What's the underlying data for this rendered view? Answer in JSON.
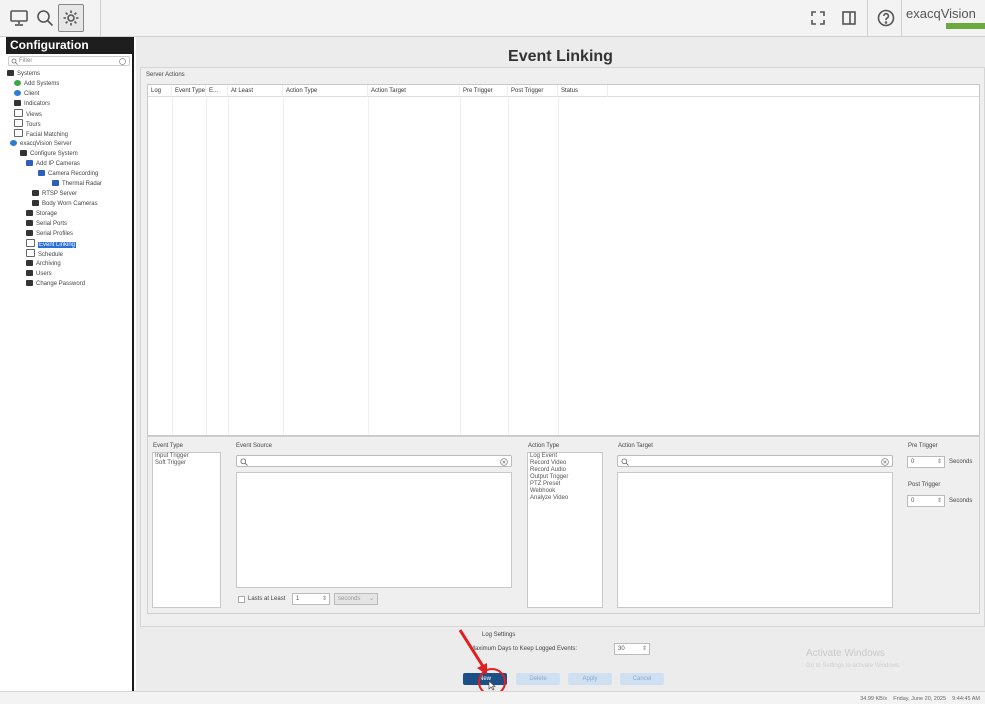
{
  "toolbar": {
    "monitor_icon": "monitor-icon",
    "search_icon": "search-icon",
    "config_icon": "gear-icon",
    "fullscreen_icon": "expand-icon",
    "sidebar_icon": "sidebar-toggle-icon",
    "help_icon": "help-icon",
    "logo_text": "exacqVision"
  },
  "nav": {
    "title": "Configuration",
    "filter_placeholder": "Filter",
    "items": [
      {
        "label": "Systems",
        "icon": "server-icon"
      },
      {
        "label": "Add Systems",
        "icon": "add-icon"
      },
      {
        "label": "Client",
        "icon": "client-icon"
      },
      {
        "label": "Indicators",
        "icon": "flag-icon"
      },
      {
        "label": "Views",
        "icon": "monitor-icon"
      },
      {
        "label": "Tours",
        "icon": "tour-icon"
      },
      {
        "label": "Facial Matching",
        "icon": "face-icon"
      },
      {
        "label": "exacqVision Server",
        "icon": "server-icon"
      },
      {
        "label": "Configure System",
        "icon": "system-icon"
      },
      {
        "label": "Add IP Cameras",
        "icon": "camera-icon"
      },
      {
        "label": "Camera Recording",
        "icon": "camera-icon"
      },
      {
        "label": "Thermal Radar",
        "icon": "camera-icon"
      },
      {
        "label": "RTSP Server",
        "icon": "rtsp-icon"
      },
      {
        "label": "Body Worn Cameras",
        "icon": "person-icon"
      },
      {
        "label": "Storage",
        "icon": "storage-icon"
      },
      {
        "label": "Serial Ports",
        "icon": "port-icon"
      },
      {
        "label": "Serial Profiles",
        "icon": "profile-icon"
      },
      {
        "label": "Event Linking",
        "icon": "link-icon"
      },
      {
        "label": "Schedule",
        "icon": "calendar-icon"
      },
      {
        "label": "Archiving",
        "icon": "archive-icon"
      },
      {
        "label": "Users",
        "icon": "user-icon"
      },
      {
        "label": "Change Password",
        "icon": "user-icon"
      }
    ],
    "selected": "Event Linking"
  },
  "main": {
    "title": "Event Linking",
    "server_actions_label": "Server Actions",
    "columns": [
      "Log",
      "Event Type",
      "E...",
      "At Least",
      "Action Type",
      "Action Target",
      "Pre Trigger",
      "Post Trigger",
      "Status"
    ]
  },
  "editor": {
    "event_type_label": "Event Type",
    "event_types": [
      "Input Trigger",
      "Soft Trigger"
    ],
    "event_source_label": "Event Source",
    "lasts_label": "Lasts at Least",
    "lasts_value": "1",
    "lasts_unit": "seconds",
    "action_type_label": "Action Type",
    "action_types": [
      "Log Event",
      "Record Video",
      "Record Audio",
      "Output Trigger",
      "PTZ Preset",
      "Webhook",
      "Analyze Video"
    ],
    "action_target_label": "Action Target",
    "pre_trigger_label": "Pre Trigger",
    "pre_trigger_value": "0",
    "post_trigger_label": "Post Trigger",
    "post_trigger_value": "0",
    "seconds_label": "Seconds"
  },
  "log_settings": {
    "title": "Log Settings",
    "max_days_label": "Maximum Days to Keep Logged Events:",
    "max_days_value": "30"
  },
  "buttons": {
    "new": "New",
    "delete": "Delete",
    "apply": "Apply",
    "cancel": "Cancel"
  },
  "watermark": {
    "title": "Activate Windows",
    "subtitle": "Go to Settings to activate Windows."
  },
  "status_bar": {
    "rate": "34.99 KB/s",
    "datetime": "Friday, June 20, 2025",
    "time": "9:44:45 AM"
  },
  "colors": {
    "accent": "#2a6fd6",
    "primary_button": "#1c4f86",
    "annotation": "#e02020"
  }
}
